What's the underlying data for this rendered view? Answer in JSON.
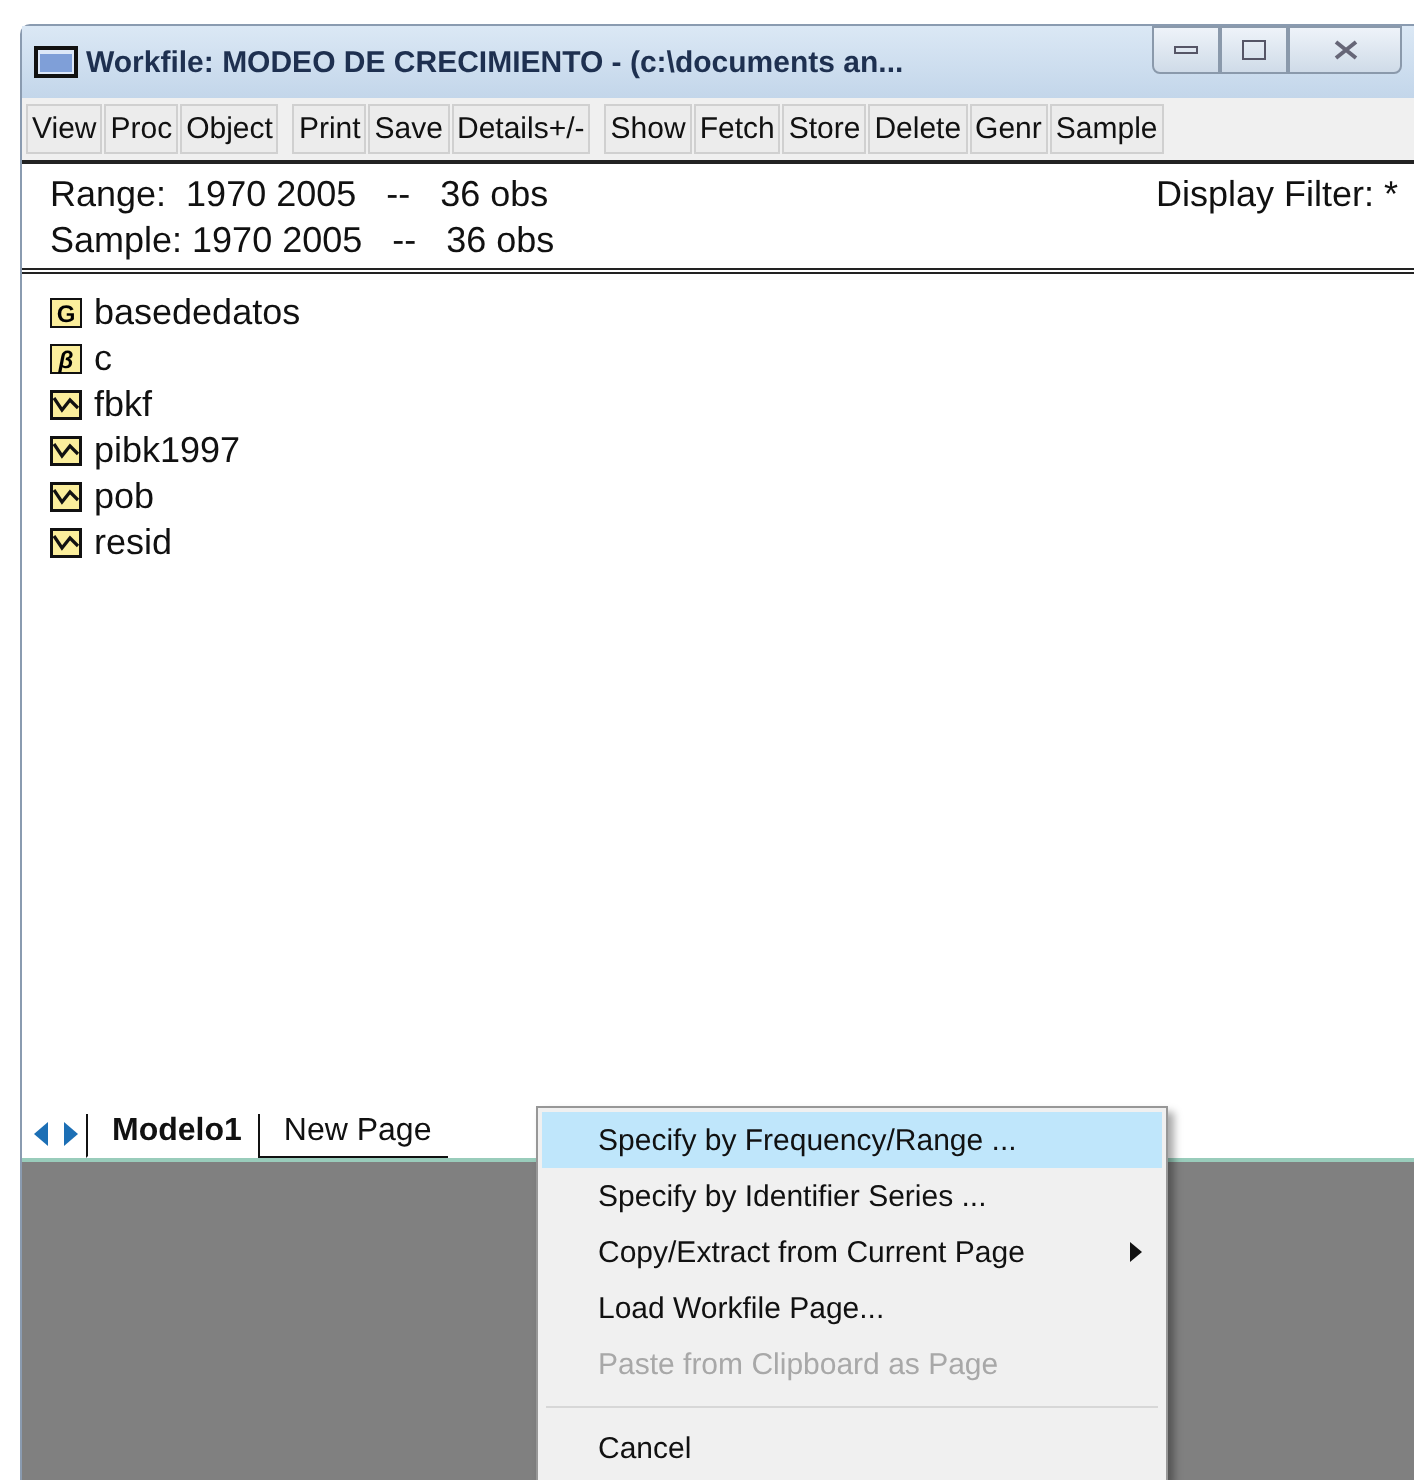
{
  "window": {
    "title": "Workfile: MODEO DE CRECIMIENTO - (c:\\documents an..."
  },
  "toolbar": [
    "View",
    "Proc",
    "Object",
    "Print",
    "Save",
    "Details+/-",
    "Show",
    "Fetch",
    "Store",
    "Delete",
    "Genr",
    "Sample"
  ],
  "info": {
    "range": "Range:  1970 2005   --   36 obs",
    "sample": "Sample: 1970 2005   --   36 obs",
    "filter": "Display Filter: *"
  },
  "objects": [
    {
      "kind": "group",
      "badge": "G",
      "name": "basededatos"
    },
    {
      "kind": "coef",
      "badge": "β",
      "name": "c"
    },
    {
      "kind": "series",
      "name": "fbkf"
    },
    {
      "kind": "series",
      "name": "pibk1997"
    },
    {
      "kind": "series",
      "name": "pob"
    },
    {
      "kind": "series",
      "name": "resid"
    }
  ],
  "page_tabs": [
    {
      "label": "Modelo1",
      "selected": true
    },
    {
      "label": "New Page",
      "selected": false
    }
  ],
  "context_menu": [
    {
      "label": "Specify by Frequency/Range ...",
      "highlighted": true,
      "disabled": false,
      "submenu": false
    },
    {
      "label": "Specify by Identifier Series ...",
      "highlighted": false,
      "disabled": false,
      "submenu": false
    },
    {
      "label": "Copy/Extract from Current Page",
      "highlighted": false,
      "disabled": false,
      "submenu": true
    },
    {
      "label": "Load Workfile Page...",
      "highlighted": false,
      "disabled": false,
      "submenu": false
    },
    {
      "label": "Paste from Clipboard as Page",
      "highlighted": false,
      "disabled": true,
      "submenu": false
    },
    {
      "kind": "separator"
    },
    {
      "label": "Cancel",
      "highlighted": false,
      "disabled": false,
      "submenu": false
    }
  ]
}
